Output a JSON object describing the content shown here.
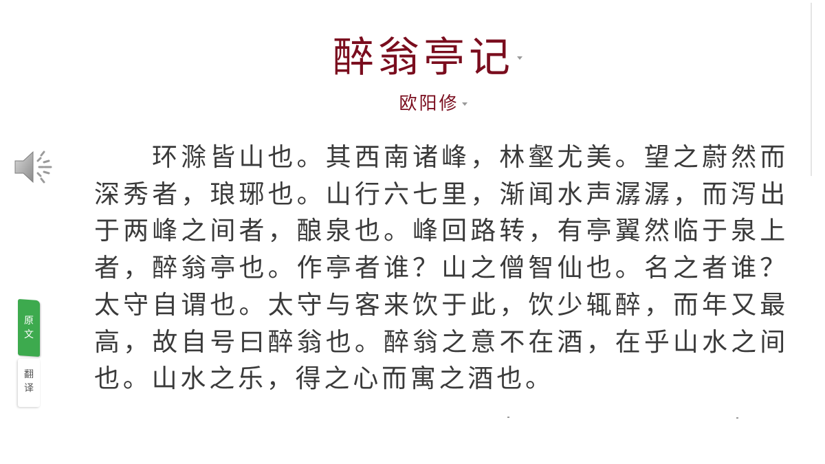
{
  "poem": {
    "title": "醉翁亭记",
    "author": "欧阳修",
    "text": "环滁皆山也。其西南诸峰，林壑尤美。望之蔚然而深秀者，琅琊也。山行六七里，渐闻水声潺潺，而泻出于两峰之间者，酿泉也。峰回路转，有亭翼然临于泉上者，醉翁亭也。作亭者谁？山之僧智仙也。名之者谁？太守自谓也。太守与客来饮于此，饮少辄醉，而年又最高，故自号曰醉翁也。醉翁之意不在酒，在乎山水之间也。山水之乐，得之心而寓之酒也。"
  },
  "side_tabs": {
    "original_line1": "原",
    "original_line2": "文",
    "translation_line1": "翻",
    "translation_line2": "译"
  },
  "icons": {
    "audio": "speaker-volume-icon",
    "title_menu": "caret-down-icon",
    "author_menu": "caret-down-icon"
  },
  "colors": {
    "title": "#7a0d1e",
    "body_text": "#3a3a3a",
    "active_tab": "#3daa4e"
  }
}
